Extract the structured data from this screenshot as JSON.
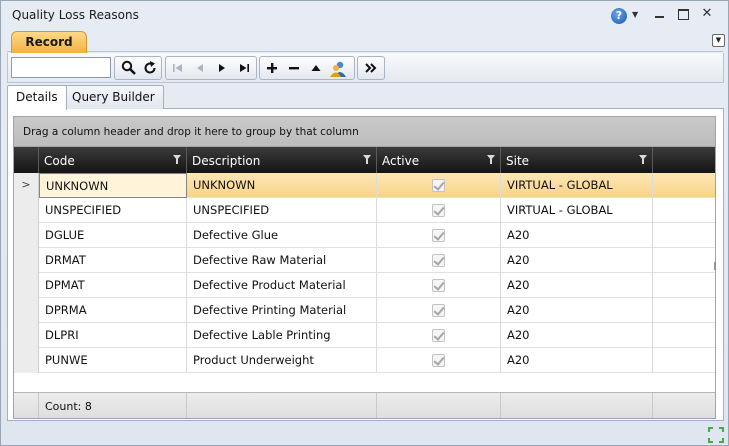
{
  "window": {
    "title": "Quality Loss Reasons"
  },
  "ribbon": {
    "tab_label": "Record"
  },
  "toolbar": {
    "search_value": "",
    "search_placeholder": ""
  },
  "tabs": [
    {
      "label": "Details",
      "active": true
    },
    {
      "label": "Query Builder",
      "active": false
    }
  ],
  "grid": {
    "group_panel_text": "Drag a column header and drop it here to group by that column",
    "columns": [
      "Code",
      "Description",
      "Active",
      "Site"
    ],
    "rows": [
      {
        "code": "UNKNOWN",
        "description": "UNKNOWN",
        "active": true,
        "site": "VIRTUAL - GLOBAL",
        "selected": true
      },
      {
        "code": "UNSPECIFIED",
        "description": "UNSPECIFIED",
        "active": true,
        "site": "VIRTUAL - GLOBAL"
      },
      {
        "code": "DGLUE",
        "description": "Defective Glue",
        "active": true,
        "site": "A20"
      },
      {
        "code": "DRMAT",
        "description": "Defective Raw Material",
        "active": true,
        "site": "A20"
      },
      {
        "code": "DPMAT",
        "description": "Defective Product Material",
        "active": true,
        "site": "A20"
      },
      {
        "code": "DPRMA",
        "description": "Defective Printing Material",
        "active": true,
        "site": "A20"
      },
      {
        "code": "DLPRI",
        "description": "Defective Lable Printing",
        "active": true,
        "site": "A20"
      },
      {
        "code": "PUNWE",
        "description": "Product Underweight",
        "active": true,
        "site": "A20"
      }
    ],
    "row_indicator": ">",
    "footer": {
      "count_label": "Count: 8"
    }
  },
  "icons": {
    "help": "?",
    "help_drop": "▼",
    "close": "✕",
    "collapse": "▼",
    "search": "search-icon",
    "refresh": "refresh-icon"
  },
  "colors": {
    "ribbon_tab": "#f2b240",
    "selected_row": "#fde6b6",
    "header_bg": "#141414"
  }
}
